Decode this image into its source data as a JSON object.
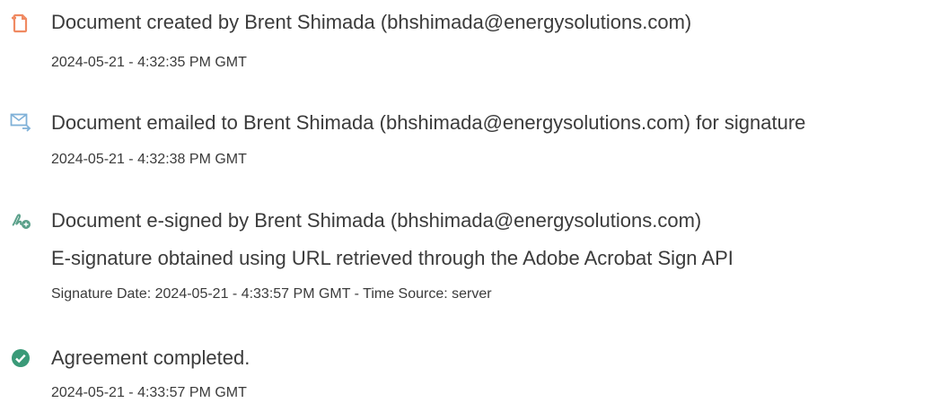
{
  "events": [
    {
      "icon": "document-created-icon",
      "message": "Document created by Brent Shimada (bhshimada@energysolutions.com)",
      "timestamp": "2024-05-21 - 4:32:35 PM GMT"
    },
    {
      "icon": "document-emailed-icon",
      "message": "Document emailed to Brent Shimada (bhshimada@energysolutions.com) for signature",
      "timestamp": "2024-05-21 - 4:32:38 PM GMT"
    },
    {
      "icon": "document-signed-icon",
      "message": "Document e-signed by Brent Shimada (bhshimada@energysolutions.com)",
      "detail": "E-signature obtained using URL retrieved through the Adobe Acrobat Sign API",
      "timestamp": "Signature Date: 2024-05-21 - 4:33:57 PM GMT - Time Source: server"
    },
    {
      "icon": "check-circle-icon",
      "message": "Agreement completed.",
      "timestamp": "2024-05-21 - 4:33:57 PM GMT"
    }
  ],
  "colors": {
    "created_icon": "#f08a62",
    "emailed_icon": "#7fb1d8",
    "signed_icon": "#5aa08a",
    "completed_icon": "#3a9a78",
    "text": "#3b3b3b"
  }
}
